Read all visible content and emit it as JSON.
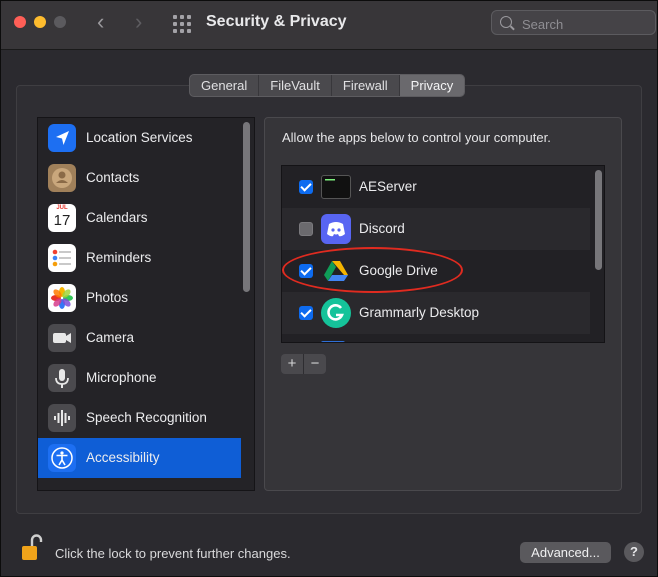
{
  "window": {
    "title": "Security & Privacy",
    "search_placeholder": "Search",
    "nav": {
      "back_glyph": "‹",
      "forward_glyph": "›"
    }
  },
  "tabs": [
    {
      "label": "General",
      "active": false
    },
    {
      "label": "FileVault",
      "active": false
    },
    {
      "label": "Firewall",
      "active": false
    },
    {
      "label": "Privacy",
      "active": true
    }
  ],
  "sidebar": {
    "items": [
      {
        "label": "Location Services",
        "icon": "location-arrow-icon",
        "selected": false
      },
      {
        "label": "Contacts",
        "icon": "contacts-icon",
        "selected": false
      },
      {
        "label": "Calendars",
        "icon": "calendar-icon",
        "selected": false,
        "icon_text": {
          "month": "JUL",
          "day": "17"
        }
      },
      {
        "label": "Reminders",
        "icon": "reminders-icon",
        "selected": false
      },
      {
        "label": "Photos",
        "icon": "photos-icon",
        "selected": false
      },
      {
        "label": "Camera",
        "icon": "camera-icon",
        "selected": false
      },
      {
        "label": "Microphone",
        "icon": "microphone-icon",
        "selected": false
      },
      {
        "label": "Speech Recognition",
        "icon": "speech-waveform-icon",
        "selected": false
      },
      {
        "label": "Accessibility",
        "icon": "accessibility-icon",
        "selected": true
      }
    ]
  },
  "main": {
    "instruction": "Allow the apps below to control your computer.",
    "apps": [
      {
        "label": "AEServer",
        "checked": true,
        "icon": "terminal-icon"
      },
      {
        "label": "Discord",
        "checked": false,
        "icon": "discord-icon"
      },
      {
        "label": "Google Drive",
        "checked": true,
        "icon": "google-drive-icon",
        "highlighted": true
      },
      {
        "label": "Grammarly Desktop",
        "checked": true,
        "icon": "grammarly-icon"
      }
    ],
    "add_label": "+",
    "remove_label": "−"
  },
  "footer": {
    "lock_text": "Click the lock to prevent further changes.",
    "advanced_label": "Advanced...",
    "help_label": "?"
  },
  "colors": {
    "selection": "#0f5ed6",
    "checkbox_on": "#0d6bf0",
    "highlight_ellipse": "#e02b20"
  }
}
